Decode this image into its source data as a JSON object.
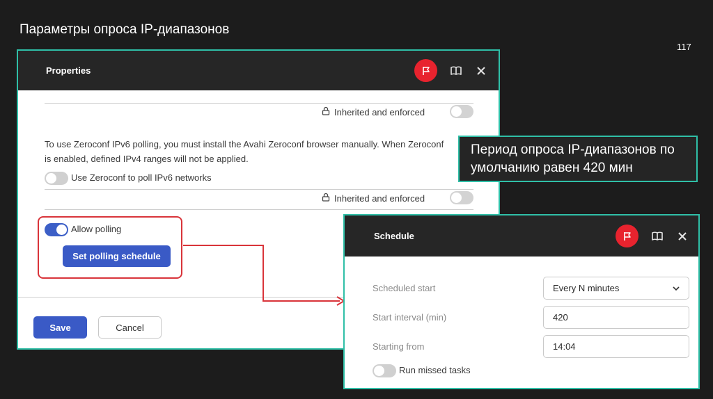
{
  "slide": {
    "title": "Параметры опроса IP-диапазонов",
    "page_number": "117"
  },
  "properties_dialog": {
    "title": "Properties",
    "header_icons": [
      "flag-icon",
      "book-icon",
      "close-icon"
    ],
    "inherited_label_1": "Inherited and enforced",
    "zeroconf_note": "To use Zeroconf IPv6 polling, you must install the Avahi Zeroconf browser manually. When Zeroconf is enabled, defined IPv4 ranges will not be applied.",
    "zeroconf_toggle_label": "Use Zeroconf to poll IPv6 networks",
    "zeroconf_toggle_on": false,
    "inherited_label_2": "Inherited and enforced",
    "allow_polling_label": "Allow polling",
    "allow_polling_on": true,
    "set_schedule_button": "Set polling schedule",
    "save_button": "Save",
    "cancel_button": "Cancel"
  },
  "callout": {
    "text": "Период опроса IP-диапазонов по умолчанию равен 420 мин"
  },
  "schedule_dialog": {
    "title": "Schedule",
    "header_icons": [
      "flag-icon",
      "book-icon",
      "close-icon"
    ],
    "scheduled_start_label": "Scheduled start",
    "scheduled_start_value": "Every N minutes",
    "start_interval_label": "Start interval (min)",
    "start_interval_value": "420",
    "starting_from_label": "Starting from",
    "starting_from_value": "14:04",
    "run_missed_label": "Run missed tasks",
    "run_missed_on": false
  },
  "colors": {
    "accent_teal": "#2fbfa7",
    "flag_red": "#e8232e",
    "primary_blue": "#3a5ac6",
    "highlight_red": "#d9343a"
  }
}
